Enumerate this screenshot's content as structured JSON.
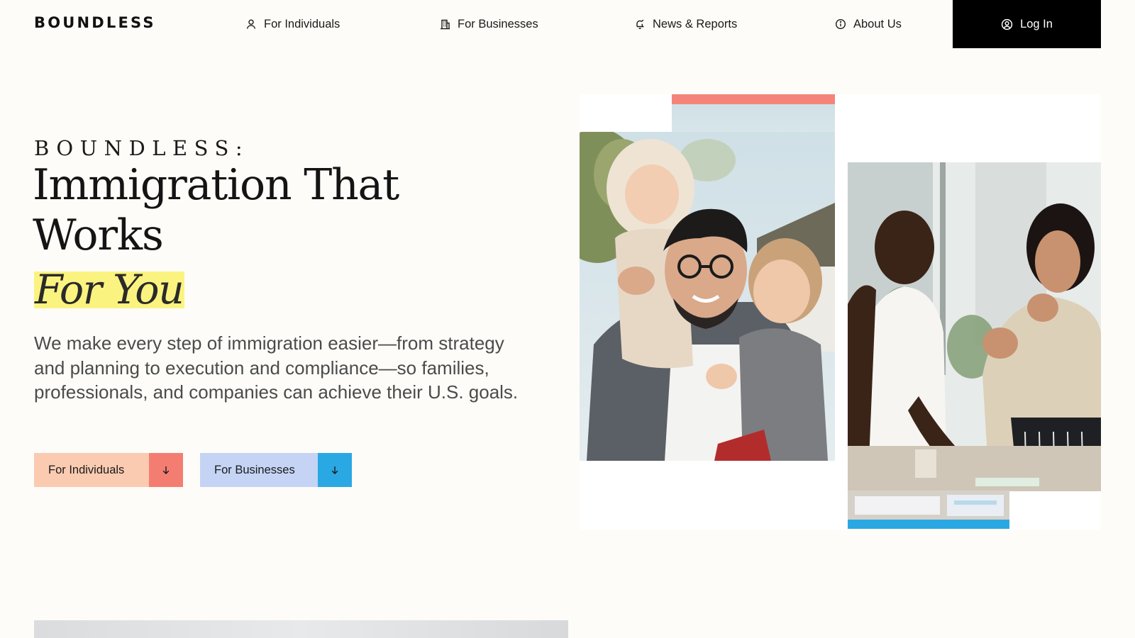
{
  "brand": {
    "logo_text": "BOUNDLESS"
  },
  "nav": {
    "items": [
      {
        "label": "For Individuals",
        "icon": "user-icon"
      },
      {
        "label": "For Businesses",
        "icon": "building-icon"
      },
      {
        "label": "News & Reports",
        "icon": "bell-icon"
      },
      {
        "label": "About Us",
        "icon": "info-icon"
      }
    ],
    "login": {
      "label": "Log In",
      "icon": "user-circle-icon"
    }
  },
  "hero": {
    "eyebrow": "BOUNDLESS:",
    "headline": "Immigration That Works",
    "highlight": "For You",
    "lead": "We make every step of immigration easier—from strategy and planning to execution and compliance—so families, professionals, and companies can achieve their U.S. goals.",
    "ctas": [
      {
        "label": "For Individuals",
        "icon": "arrow-down-icon"
      },
      {
        "label": "For Businesses",
        "icon": "arrow-down-icon"
      }
    ]
  },
  "colors": {
    "background": "#fdfcf8",
    "login_bg": "#000000",
    "highlight": "#fbf380",
    "individuals_button": "#fbcbb1",
    "individuals_arrow": "#f47d72",
    "businesses_button": "#c5d4f5",
    "businesses_arrow": "#2aa8e3",
    "accent_coral": "#f4847b",
    "accent_blue": "#2aa8e3"
  }
}
